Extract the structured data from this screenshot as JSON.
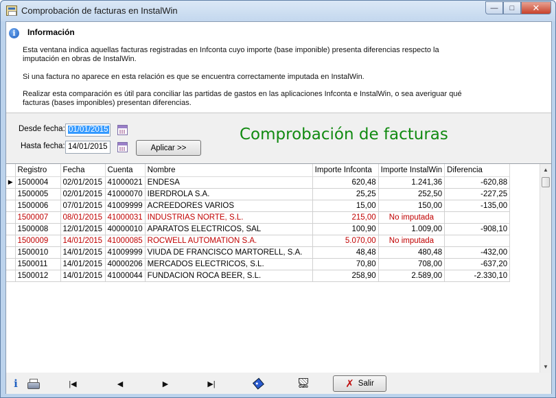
{
  "window": {
    "title": "Comprobación de facturas en InstalWin",
    "controls": {
      "minimize": "—",
      "maximize": "□",
      "close": "✕"
    }
  },
  "info": {
    "title": "Información",
    "paragraphs": [
      "Esta ventana indica aquellas facturas registradas en Infconta cuyo importe (base imponible) presenta diferencias respecto la imputación en obras de InstalWin.",
      "Si una factura no aparece en esta relación es que se encuentra correctamente imputada en InstalWin.",
      "Realizar esta comparación es útil para conciliar las partidas de gastos en las aplicaciones Infconta e InstalWin, o sea averiguar qué facturas (bases imponibles) presentan diferencias."
    ]
  },
  "filter": {
    "from_label": "Desde fecha:",
    "from_value": "01/01/2015",
    "to_label": "Hasta fecha:",
    "to_value": "14/01/2015",
    "apply_label": "Aplicar >>",
    "heading": "Comprobación de facturas"
  },
  "table": {
    "columns": [
      "Registro",
      "Fecha",
      "Cuenta",
      "Nombre",
      "Importe Infconta",
      "Importe InstalWin",
      "Diferencia"
    ],
    "current_row_marker": "▶",
    "rows": [
      {
        "registro": "1500004",
        "fecha": "02/01/2015",
        "cuenta": "41000021",
        "nombre": "ENDESA",
        "infconta": "620,48",
        "instalwin": "1.241,36",
        "diferencia": "-620,88",
        "highlight": false
      },
      {
        "registro": "1500005",
        "fecha": "02/01/2015",
        "cuenta": "41000070",
        "nombre": "IBERDROLA S.A.",
        "infconta": "25,25",
        "instalwin": "252,50",
        "diferencia": "-227,25",
        "highlight": false
      },
      {
        "registro": "1500006",
        "fecha": "07/01/2015",
        "cuenta": "41009999",
        "nombre": "ACREEDORES VARIOS",
        "infconta": "15,00",
        "instalwin": "150,00",
        "diferencia": "-135,00",
        "highlight": false
      },
      {
        "registro": "1500007",
        "fecha": "08/01/2015",
        "cuenta": "41000031",
        "nombre": "INDUSTRIAS NORTE, S.L.",
        "infconta": "215,00",
        "instalwin": "No imputada",
        "diferencia": "",
        "highlight": true
      },
      {
        "registro": "1500008",
        "fecha": "12/01/2015",
        "cuenta": "40000010",
        "nombre": "APARATOS ELECTRICOS, SAL",
        "infconta": "100,90",
        "instalwin": "1.009,00",
        "diferencia": "-908,10",
        "highlight": false
      },
      {
        "registro": "1500009",
        "fecha": "14/01/2015",
        "cuenta": "41000085",
        "nombre": "ROCWELL AUTOMATION S.A.",
        "infconta": "5.070,00",
        "instalwin": "No imputada",
        "diferencia": "",
        "highlight": true
      },
      {
        "registro": "1500010",
        "fecha": "14/01/2015",
        "cuenta": "41009999",
        "nombre": "VIUDA DE FRANCISCO MARTORELL, S.A.",
        "infconta": "48,48",
        "instalwin": "480,48",
        "diferencia": "-432,00",
        "highlight": false
      },
      {
        "registro": "1500011",
        "fecha": "14/01/2015",
        "cuenta": "40000206",
        "nombre": "MERCADOS ELECTRICOS, S.L.",
        "infconta": "70,80",
        "instalwin": "708,00",
        "diferencia": "-637,20",
        "highlight": false
      },
      {
        "registro": "1500012",
        "fecha": "14/01/2015",
        "cuenta": "41000044",
        "nombre": "FUNDACION ROCA BEER, S.L.",
        "infconta": "258,90",
        "instalwin": "2.589,00",
        "diferencia": "-2.330,10",
        "highlight": false
      }
    ],
    "highlight_color": "#c00000"
  },
  "scrollbar": {
    "up": "▲",
    "down": "▼"
  },
  "toolbar": {
    "info_glyph": "i",
    "first": "|◀",
    "prev": "◀",
    "next": "▶",
    "last": "▶|",
    "gato_label": "Gato",
    "exit_label": "Salir",
    "exit_glyph": "✗"
  }
}
